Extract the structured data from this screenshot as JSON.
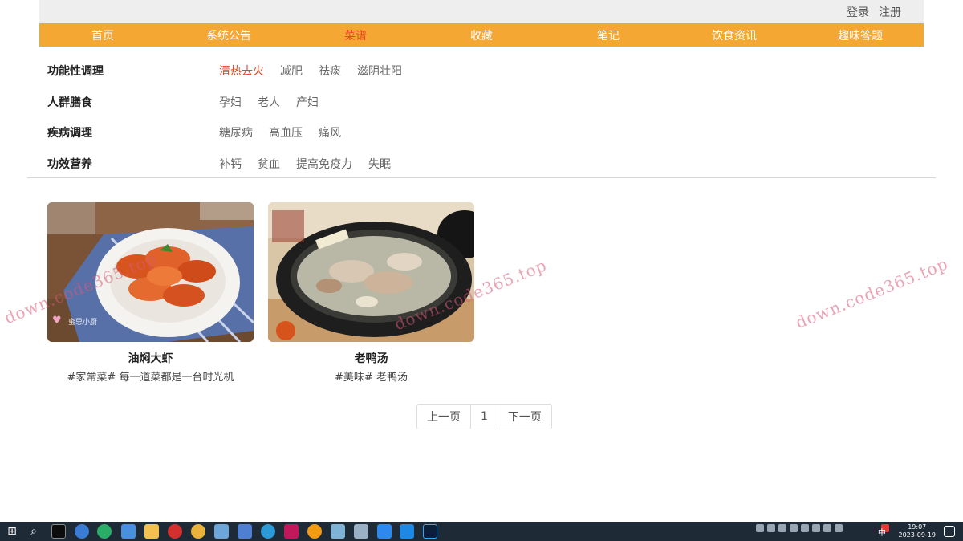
{
  "auth": {
    "login": "登录",
    "register": "注册"
  },
  "nav": [
    {
      "label": "首页",
      "active": false
    },
    {
      "label": "系统公告",
      "active": false
    },
    {
      "label": "菜谱",
      "active": true
    },
    {
      "label": "收藏",
      "active": false
    },
    {
      "label": "笔记",
      "active": false
    },
    {
      "label": "饮食资讯",
      "active": false
    },
    {
      "label": "趣味答题",
      "active": false
    }
  ],
  "filters": [
    {
      "title": "功能性调理",
      "options": [
        "清热去火",
        "减肥",
        "祛痰",
        "滋阴壮阳"
      ],
      "active": "清热去火"
    },
    {
      "title": "人群膳食",
      "options": [
        "孕妇",
        "老人",
        "产妇"
      ]
    },
    {
      "title": "疾病调理",
      "options": [
        "糖尿病",
        "高血压",
        "痛风"
      ]
    },
    {
      "title": "功效营养",
      "options": [
        "补钙",
        "贫血",
        "提高免疫力",
        "失眠"
      ]
    }
  ],
  "recipes": [
    {
      "title": "油焖大虾",
      "desc": "#家常菜# 每一道菜都是一台时光机",
      "photo_watermark": "蜜思小厨"
    },
    {
      "title": "老鸭汤",
      "desc": "#美味# 老鸭汤"
    }
  ],
  "pager": {
    "prev": "上一页",
    "page": "1",
    "next": "下一页"
  },
  "watermark": "down.code365.top",
  "taskbar": {
    "ime": "中",
    "time": "19:07",
    "date": "2023-09-19"
  },
  "colors": {
    "nav_bg": "#f5a733",
    "active": "#e8441f",
    "topbar_bg": "#eeeeee"
  }
}
